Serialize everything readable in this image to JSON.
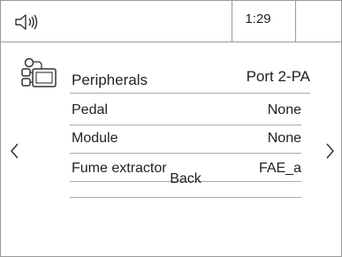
{
  "status": {
    "time": "1:29"
  },
  "header": {
    "title": "Peripherals",
    "port": "Port 2-PA"
  },
  "rows": [
    {
      "label": "Pedal",
      "value": "None"
    },
    {
      "label": "Module",
      "value": "None"
    },
    {
      "label": "Fume extractor",
      "value": "FAE_a"
    }
  ],
  "back_label": "Back",
  "icons": {
    "speaker": "speaker-volume-icon",
    "device": "peripherals-device-icon",
    "prev": "chevron-left-icon",
    "next": "chevron-right-icon"
  },
  "colors": {
    "background": "#ffffff",
    "text": "#222222",
    "lines": "#9a9a9a"
  }
}
